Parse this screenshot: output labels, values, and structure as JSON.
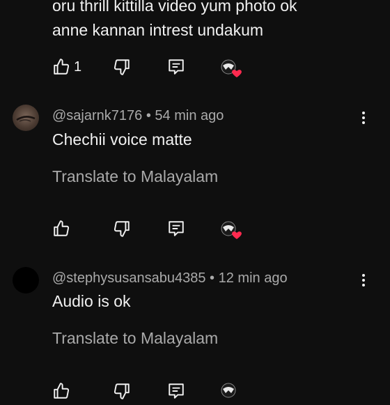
{
  "comments": [
    {
      "body_lines": [
        "oru thrill kittilla video yum photo ok",
        "anne kannan intrest undakum"
      ],
      "like_count": "1"
    },
    {
      "author": "@sajarnk7176",
      "separator": "•",
      "time": "54 min ago",
      "body": "Chechii voice matte",
      "translate": "Translate to Malayalam"
    },
    {
      "author": "@stephysusansabu4385",
      "separator": "•",
      "time": "12 min ago",
      "body": "Audio is ok",
      "translate": "Translate to Malayalam"
    }
  ],
  "icons": {
    "like": "thumbs-up-icon",
    "dislike": "thumbs-down-icon",
    "reply": "reply-icon",
    "creator_heart": "creator-heart-icon",
    "menu": "more-vertical-icon"
  },
  "colors": {
    "background": "#0f0f0f",
    "text": "#f1f1f1",
    "secondary_text": "#aaaaaa",
    "heart": "#ff2a4f"
  }
}
